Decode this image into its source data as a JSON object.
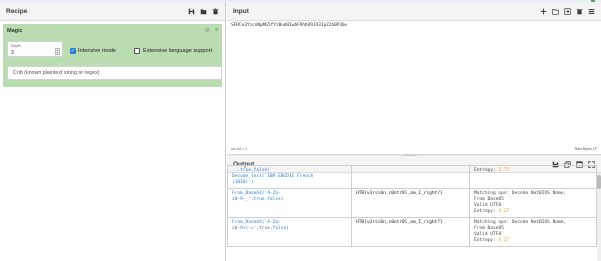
{
  "recipe": {
    "title": "Recipe",
    "icons": [
      "save-icon",
      "folder-icon",
      "trash-icon"
    ],
    "operation": {
      "name": "Magic",
      "depth_label": "Depth",
      "depth_value": "3",
      "intensive_mode_label": "Intensive mode",
      "intensive_mode_checked": true,
      "extensive_language_label": "Extensive language support",
      "extensive_language_checked": false,
      "crib_placeholder": "Crib (known plaintext string or regex)"
    }
  },
  "input": {
    "title": "Input",
    "value": "SFRCe3YzcnNpMG5fYzBudHIwbF9hbV9JX3JpZ2h0P30=",
    "status_left": "rec 44  = 1",
    "status_right": "Raw Bytes  LF"
  },
  "output": {
    "title": "Output",
    "rows": [
      {
        "recipe_lines": [
          "...true,false)",
          "Decode_text('IBM EBCDIC French",
          "(1010)')"
        ],
        "result": "",
        "props": [
          "Entropy: 3.77"
        ]
      },
      {
        "recipe_lines": [
          "From_Base64('A-Za-",
          "z0-9-_',true,false)"
        ],
        "result": "HTB{v3rsi0n_c0ntr0l_am_I_right?}",
        "props": [
          "Matching ops: Decode NetBIOS Name,",
          "From Base85",
          "Valid UTF8",
          "Entropy: 4.27"
        ]
      },
      {
        "recipe_lines": [
          "From_Base64('A-Za-",
          "z0-9+\\-=',true,false)"
        ],
        "result": "HTB{v3rsi0n_c0ntr0l_am_I_right?}",
        "props": [
          "Matching ops: Decode NetBIOS Name,",
          "From Base85",
          "Valid UTF8",
          "Entropy: 4.27"
        ]
      }
    ]
  },
  "colors": {
    "operation_bg": "#b9dcb1",
    "accent_blue": "#2d7dd2",
    "entropy_orange": "#e6a020"
  }
}
